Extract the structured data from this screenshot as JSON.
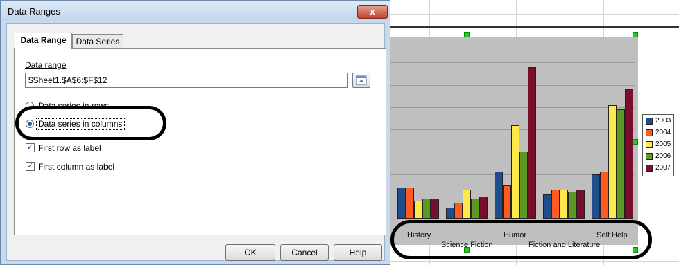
{
  "dialog": {
    "title": "Data Ranges",
    "close_glyph": "x",
    "tabs": [
      {
        "label": "Data Range"
      },
      {
        "label": "Data Series"
      }
    ],
    "data_range_label": "Data range",
    "data_range_value": "$Sheet1.$A$6:$F$12",
    "radio_rows_label": "Data series in rows",
    "radio_columns_label": "Data series in columns",
    "first_row_label": "First row as label",
    "first_column_label": "First column as label",
    "check_glyph": "✓",
    "buttons": {
      "ok": "OK",
      "cancel": "Cancel",
      "help": "Help"
    }
  },
  "chart_data": {
    "type": "bar",
    "categories": [
      "History",
      "Science Fiction",
      "Humor",
      "Fiction and Literature",
      "Self Help"
    ],
    "series": [
      {
        "name": "2003",
        "color": "#1f4e8c",
        "values": [
          14,
          5,
          21,
          11,
          20
        ]
      },
      {
        "name": "2004",
        "color": "#ff5a1f",
        "values": [
          14,
          7,
          15,
          13,
          21
        ]
      },
      {
        "name": "2005",
        "color": "#ffe94a",
        "values": [
          8,
          13,
          42,
          13,
          51
        ]
      },
      {
        "name": "2006",
        "color": "#5c9a23",
        "values": [
          9,
          9,
          30,
          12,
          49
        ]
      },
      {
        "name": "2007",
        "color": "#7a0f2b",
        "values": [
          9,
          10,
          68,
          13,
          58
        ]
      }
    ],
    "ylim": [
      0,
      80
    ],
    "legend": "right"
  }
}
